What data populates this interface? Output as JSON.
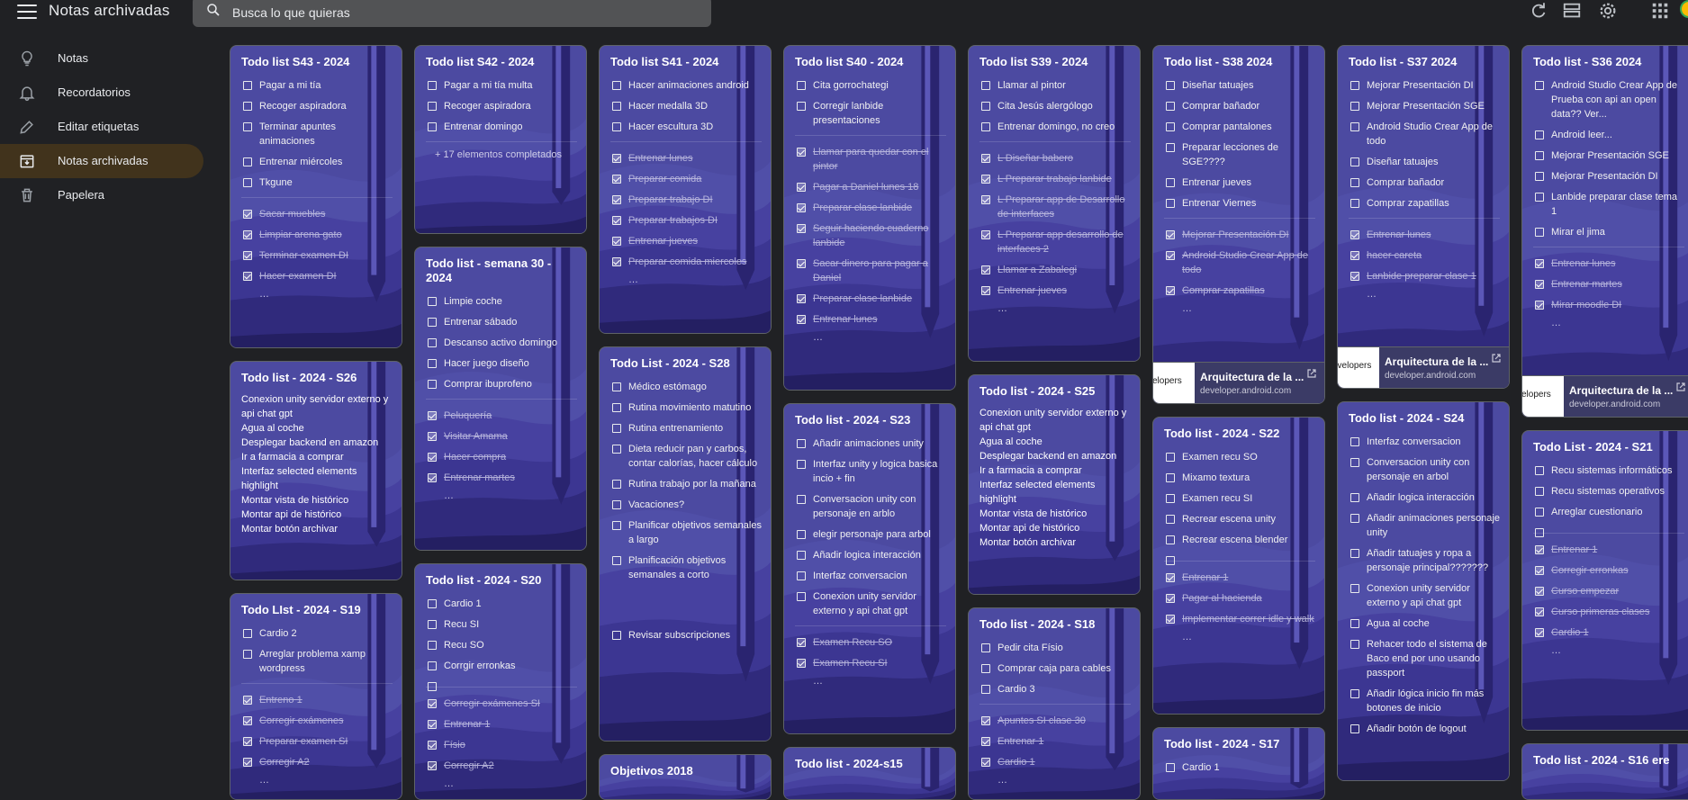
{
  "header": {
    "title": "Notas archivadas",
    "search_placeholder": "Busca lo que quieras"
  },
  "sidebar": {
    "items": [
      {
        "label": "Notas",
        "icon": "lightbulb-icon"
      },
      {
        "label": "Recordatorios",
        "icon": "bell-icon"
      },
      {
        "label": "Editar etiquetas",
        "icon": "pencil-icon"
      },
      {
        "label": "Notas archivadas",
        "icon": "archive-icon",
        "active": true
      },
      {
        "label": "Papelera",
        "icon": "trash-icon"
      }
    ]
  },
  "colors": {
    "note_bg": "#4c4aa1",
    "active_nav": "#41331c",
    "background": "#202124"
  },
  "notes": {
    "s43": {
      "title": "Todo list S43 - 2024",
      "items": [
        "Pagar a mi tía",
        "Recoger aspiradora",
        "Terminar apuntes animaciones",
        "Entrenar miércoles",
        "Tkgune"
      ],
      "done": [
        "Sacar muebles",
        "Limpiar arena gato",
        "Terminar examen DI",
        "Hacer examen DI"
      ]
    },
    "s42": {
      "title": "Todo list S42 - 2024",
      "items": [
        "Pagar a mi tía multa",
        "Recoger aspiradora",
        "Entrenar domingo"
      ],
      "completed": "+ 17 elementos completados"
    },
    "s41": {
      "title": "Todo list S41 - 2024",
      "items": [
        "Hacer animaciones android",
        "Hacer medalla 3D",
        "Hacer escultura 3D"
      ],
      "done": [
        "Entrenar lunes",
        "Preparar comida",
        "Preparar trabajo DI",
        "Preparar trabajos DI",
        "Entrenar jueves",
        "Preparar comida miercoles"
      ]
    },
    "s40": {
      "title": "Todo list S40 - 2024",
      "items": [
        "Cita gorrochategi",
        "Corregir lanbide presentaciones"
      ],
      "done": [
        "Llamar para quedar con el pintor",
        "Pagar a Daniel lunes 18",
        "Preparar clase lanbide",
        "Seguir haciendo cuaderno lanbide",
        "Sacar dinero para pagar a Daniel",
        "Preparar clase lanbide",
        "Entrenar lunes"
      ]
    },
    "s39": {
      "title": "Todo list S39 - 2024",
      "items": [
        "Llamar al pintor",
        "Cita Jesús alergólogo",
        "Entrenar domingo, no creo"
      ],
      "done": [
        "L Diseñar babero",
        "L Preparar trabajo lanbide",
        "L Preparar app de Desarrollo de interfaces",
        "L Preparar app desarrollo de interfaces 2",
        "Llamar a Zabalegi",
        "Entrenar jueves"
      ]
    },
    "s38": {
      "title": "Todo list - S38 2024",
      "items": [
        "Diseñar tatuajes",
        "Comprar bañador",
        "Comprar pantalones",
        "Preparar lecciones de SGE????",
        "Entrenar jueves",
        "Entrenar Viernes"
      ],
      "done": [
        "Mejorar Presentación DI",
        "Android Studio Crear App de todo",
        "Comprar zapatillas"
      ],
      "link": {
        "thumb": "velopers",
        "title": "Arquitectura de la ...",
        "domain": "developer.android.com"
      }
    },
    "s37": {
      "title": "Todo list - S37 2024",
      "items": [
        "Mejorar Presentación DI",
        "Mejorar Presentación SGE",
        "Android Studio Crear App de todo",
        "Diseñar tatuajes",
        "Comprar bañador",
        "Comprar zapatillas"
      ],
      "done": [
        "Entrenar lunes",
        "hacer careta",
        "Lanbide preparar clase 1"
      ],
      "link": {
        "thumb": "evelopers",
        "title": "Arquitectura de la ...",
        "domain": "developer.android.com"
      }
    },
    "s36": {
      "title": "Todo list - S36 2024",
      "items": [
        "Android Studio Crear App de Prueba con api an open data?? Ver...",
        "Android leer...",
        "Mejorar Presentación SGE",
        "Mejorar Presentación DI",
        "Lanbide preparar clase tema 1",
        "Mirar el jima"
      ],
      "done": [
        "Entrenar lunes",
        "Entrenar martes",
        "Mirar moodle DI"
      ],
      "link": {
        "thumb": "velopers",
        "title": "Arquitectura de la ...",
        "domain": "developer.android.com"
      }
    },
    "s26": {
      "title": "Todo list - 2024 - S26",
      "lines": [
        "Conexion unity servidor externo y api chat gpt",
        "Agua al coche",
        "Desplegar backend en amazon",
        "Ir a farmacia a comprar",
        "Interfaz selected elements highlight",
        "Montar vista de histórico",
        "Montar api de histórico",
        "Montar botón archivar"
      ]
    },
    "sem30": {
      "title": "Todo list - semana 30 - 2024",
      "items": [
        "Limpie coche",
        "Entrenar sábado",
        "Descanso activo domingo",
        "Hacer juego diseño",
        "Comprar ibuprofeno"
      ],
      "done": [
        "Peluquería",
        "Visitar Amama",
        "Hacer compra",
        "Entrenar martes"
      ]
    },
    "s28": {
      "title": "Todo List - 2024 - S28",
      "items": [
        "Médico estómago",
        "Rutina movimiento matutino",
        "Rutina entrenamiento",
        "Dieta reducir pan y carbos, contar calorías, hacer cálculo",
        "Rutina trabajo por la mañana",
        "Vacaciones?",
        "Planificar objetivos semanales a largo",
        "Planificación objetivos semanales a corto"
      ],
      "last": "Revisar subscripciones"
    },
    "s23": {
      "title": "Todo list - 2024 - S23",
      "items": [
        "Añadir animaciones unity",
        "Interfaz unity y logica basica incio + fin",
        "Conversacion unity con personaje en arblo",
        "elegir personaje para arbol",
        "Añadir logica interacción",
        "Interfaz conversacion",
        "Conexion unity servidor externo y api chat gpt"
      ],
      "done": [
        "Examen Recu SO",
        "Examen Recu SI"
      ]
    },
    "s25": {
      "title": "Todo list - 2024 - S25",
      "lines": [
        "Conexion unity servidor externo y api chat gpt",
        "Agua al coche",
        "Desplegar backend en amazon",
        "Ir a farmacia a comprar",
        "Interfaz selected elements highlight",
        "Montar vista de histórico",
        "Montar api de histórico",
        "Montar botón archivar"
      ]
    },
    "s22": {
      "title": "Todo list - 2024 - S22",
      "items": [
        "Examen recu SO",
        "Mixamo textura",
        "Examen recu SI",
        "Recrear escena unity",
        "Recrear escena blender",
        ""
      ],
      "done": [
        "Entrenar 1",
        "Pagar al hacienda",
        "Implementar correr idle y walk"
      ]
    },
    "s24": {
      "title": "Todo list - 2024 - S24",
      "items": [
        "Interfaz conversacion",
        "Conversacion unity con personaje en arbol",
        "Añadir logica interacción",
        "Añadir animaciones personaje unity",
        "Añadir tatuajes y ropa a personaje principal???????",
        "Conexion unity servidor externo y api chat gpt",
        "Agua al coche",
        "Rehacer todo el sistema de Baco end por uno usando passport",
        "Añadir lógica inicio fin más botones de inicio",
        "Añadir botón de logout"
      ]
    },
    "s21": {
      "title": "Todo List - 2024 - S21",
      "items": [
        "Recu sistemas informáticos",
        "Recu sistemas operativos",
        "Arreglar cuestionario",
        ""
      ],
      "done": [
        "Entrenar 1",
        "Corregir erronkas",
        "Curso empezar",
        "Curso primeras clases",
        "Cardio 1"
      ]
    },
    "s19": {
      "title": "Todo LIst - 2024 - S19",
      "items": [
        "Cardio 2",
        "Arreglar problema xamp wordpress"
      ],
      "done": [
        "Entreno 1",
        "Corregir exámenes",
        "Preparar examen SI",
        "Corregir A2"
      ]
    },
    "s20": {
      "title": "Todo list - 2024 - S20",
      "items": [
        "Cardio 1",
        "Recu SI",
        "Recu SO",
        "Corrgir erronkas",
        ""
      ],
      "done": [
        "Corregir exámenes SI",
        "Entrenar 1",
        "Físio",
        "Corregir A2"
      ]
    },
    "s18": {
      "title": "Todo list - 2024 - S18",
      "items": [
        "Pedir cita Físio",
        "Comprar caja para cables",
        "Cardio 3"
      ],
      "done": [
        "Apuntes SI clase 30",
        "Entrenar 1",
        "Cardio 1"
      ]
    },
    "s15": {
      "title": "Todo list - 2024-s15"
    },
    "s17": {
      "title": "Todo list - 2024 - S17",
      "items": [
        "Cardio 1"
      ]
    },
    "obj": {
      "title": "Objetivos 2018"
    },
    "s16": {
      "title": "Todo list - 2024 - S16 ere"
    }
  }
}
